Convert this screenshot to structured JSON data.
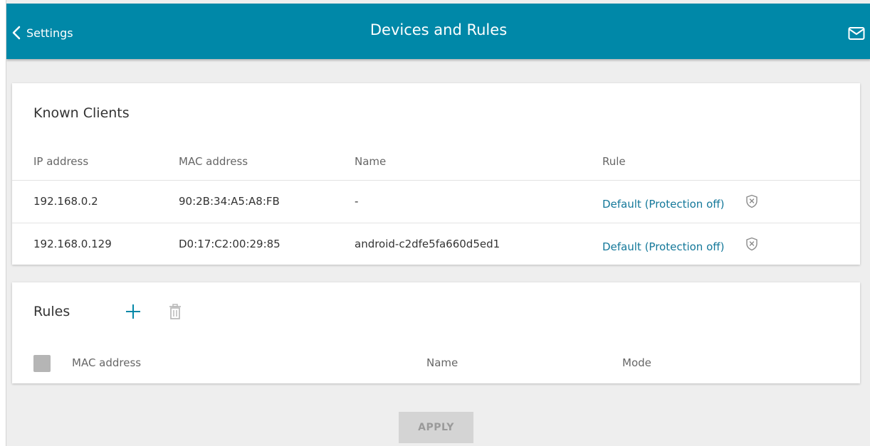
{
  "header": {
    "back_label": "Settings",
    "title": "Devices and Rules",
    "color": "#0088a8"
  },
  "known_clients": {
    "title": "Known Clients",
    "columns": [
      "IP address",
      "MAC address",
      "Name",
      "Rule"
    ],
    "rows": [
      {
        "ip": "192.168.0.2",
        "mac": "90:2B:34:A5:A8:FB",
        "name": "-",
        "rule": "Default (Protection off)"
      },
      {
        "ip": "192.168.0.129",
        "mac": "D0:17:C2:00:29:85",
        "name": "android-c2dfe5fa660d5ed1",
        "rule": "Default (Protection off)"
      }
    ],
    "row_icon": "shield-x-icon"
  },
  "rules": {
    "title": "Rules",
    "add_icon": "plus-icon",
    "delete_icon": "trash-icon",
    "columns": [
      "MAC address",
      "Name",
      "Mode"
    ]
  },
  "apply_label": "APPLY",
  "icons": {
    "back": "chevron-left-icon",
    "mail": "mail-icon"
  },
  "colors": {
    "accent": "#0088a8",
    "link": "#14789a",
    "button_disabled": "#d4d4d4"
  }
}
